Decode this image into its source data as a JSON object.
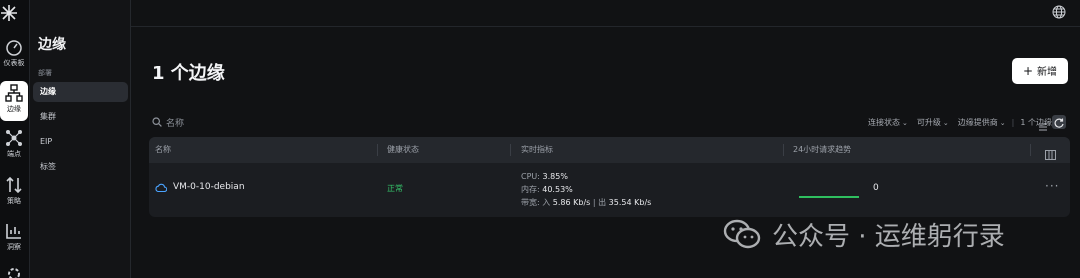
{
  "rail": {
    "items": [
      {
        "label": "仪表板",
        "icon": "gauge-icon"
      },
      {
        "label": "边缘",
        "icon": "edge-icon"
      },
      {
        "label": "端点",
        "icon": "network-icon"
      },
      {
        "label": "策略",
        "icon": "arrows-icon"
      },
      {
        "label": "洞察",
        "icon": "chart-icon"
      }
    ]
  },
  "sidebar": {
    "title": "边缘",
    "group": "部署",
    "items": [
      {
        "label": "边缘"
      },
      {
        "label": "集群"
      },
      {
        "label": "EIP"
      },
      {
        "label": "标签"
      }
    ]
  },
  "main": {
    "title": "1 个边缘",
    "new_button": "新增",
    "search_placeholder": "名称",
    "filters": {
      "connection": "连接状态",
      "upgradable": "可升级",
      "provider": "边缘提供商",
      "count": "1 个边缘"
    }
  },
  "table": {
    "headers": {
      "name": "名称",
      "health": "健康状态",
      "metrics": "实时指标",
      "trend": "24小时请求趋势"
    },
    "rows": [
      {
        "name": "VM-0-10-debian",
        "health": "正常",
        "cpu_label": "CPU:",
        "cpu": "3.85%",
        "mem_label": "内存:",
        "mem": "40.53%",
        "bw_label": "带宽:",
        "bw_in_label": "入",
        "bw_in": "5.86 Kb/s",
        "bw_out_label": "出",
        "bw_out": "35.54 Kb/s",
        "trend_value": "0"
      }
    ]
  },
  "watermark": "公众号 · 运维躬行录",
  "colors": {
    "background": "#111214",
    "healthy": "#35c46a",
    "trend_line": "#2fbf5f",
    "primary_button": "#ffffff"
  }
}
